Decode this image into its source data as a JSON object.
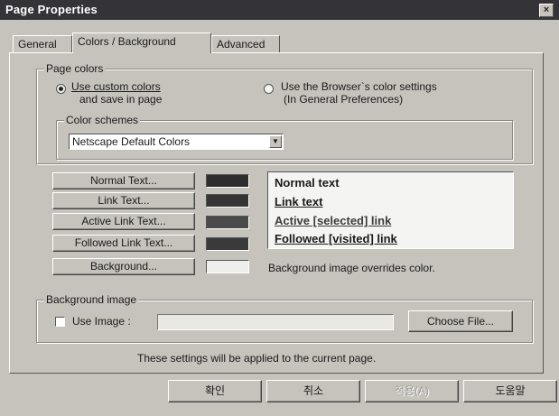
{
  "window": {
    "title": "Page Properties",
    "close_glyph": "×"
  },
  "tabs": [
    {
      "label": "General"
    },
    {
      "label": "Colors / Background"
    },
    {
      "label": "Advanced"
    }
  ],
  "page_colors": {
    "legend": "Page colors",
    "custom_line1": "Use custom colors",
    "custom_line2": "and save in page",
    "browser_line1": "Use the Browser`s color settings",
    "browser_line2": "(In General Preferences)",
    "custom_selected": true
  },
  "color_schemes": {
    "legend": "Color schemes",
    "selected": "Netscape Default Colors"
  },
  "color_buttons": [
    {
      "label": "Normal Text...",
      "swatch": "#2e2e2e"
    },
    {
      "label": "Link Text...",
      "swatch": "#353535"
    },
    {
      "label": "Active Link Text...",
      "swatch": "#4a4a4a"
    },
    {
      "label": "Followed Link Text...",
      "swatch": "#3a3a3a"
    },
    {
      "label": "Background...",
      "swatch": "#eeeeec"
    }
  ],
  "preview": {
    "normal": "Normal text",
    "link": "Link text",
    "active": "Active [selected] link",
    "followed": "Followed [visited] link"
  },
  "background_note": "Background image overrides color.",
  "background_image": {
    "legend": "Background image",
    "use_image_label": "Use Image :",
    "value": "",
    "choose_label": "Choose File..."
  },
  "footer_note": "These settings will be applied to the current page.",
  "footer_buttons": {
    "ok": "확인",
    "cancel": "취소",
    "apply": "적용(A)",
    "help": "도움말"
  }
}
